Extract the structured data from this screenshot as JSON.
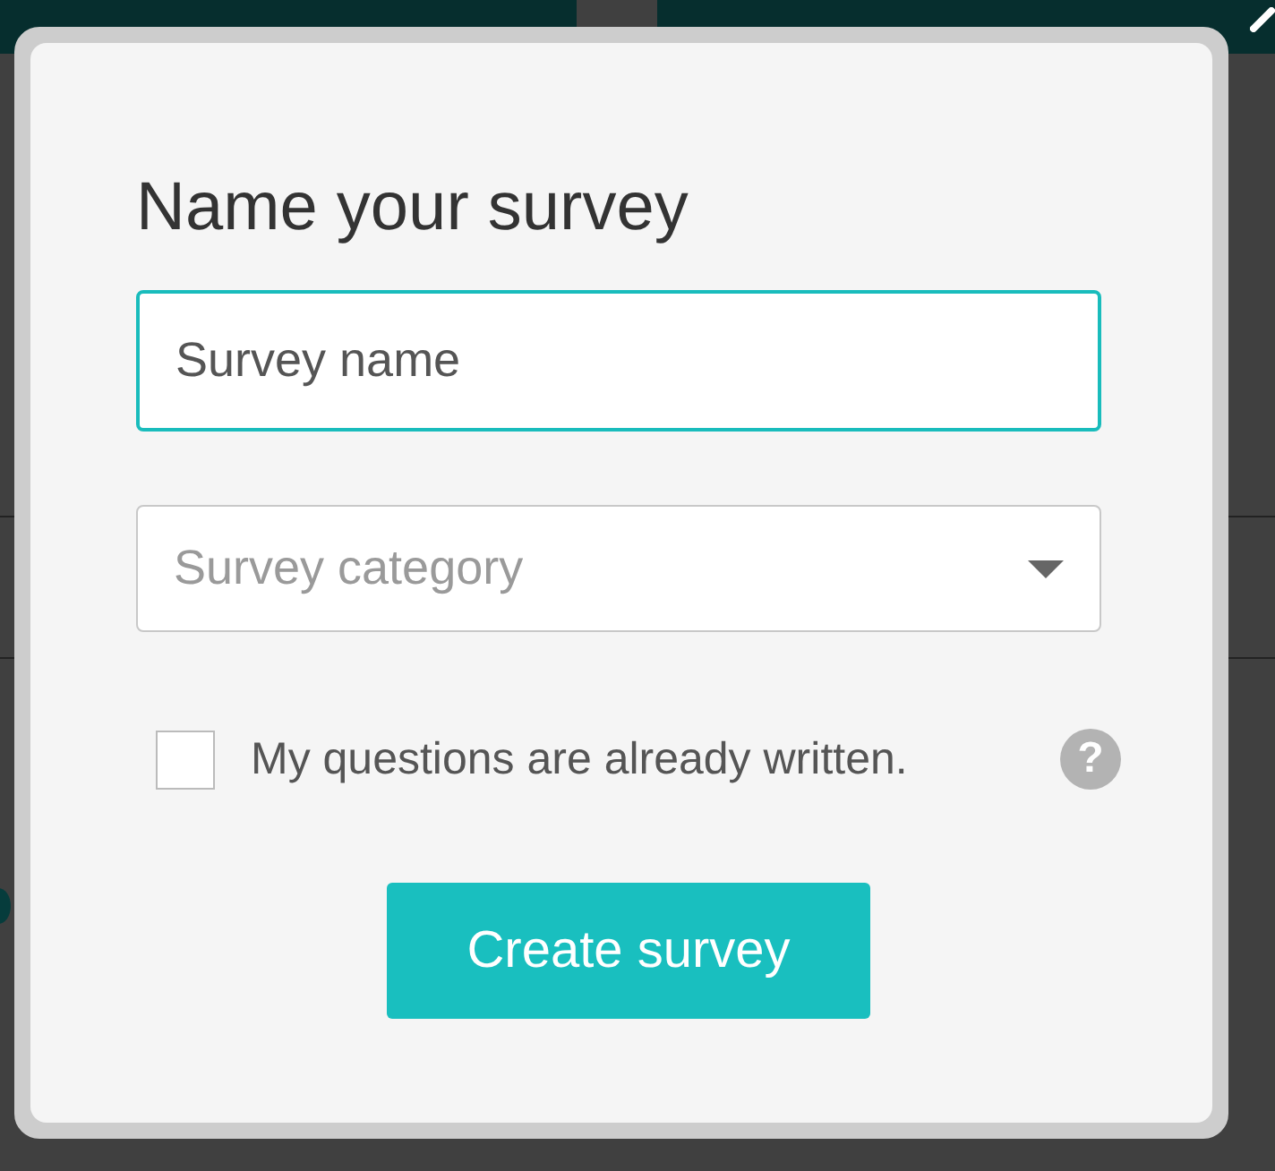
{
  "dialog": {
    "title": "Name your survey",
    "name_field": {
      "placeholder": "Survey name",
      "focused": true
    },
    "category_select": {
      "placeholder": "Survey category"
    },
    "checkbox": {
      "label": "My questions are already written.",
      "checked": false
    },
    "help": "?",
    "submit": "Create survey"
  }
}
